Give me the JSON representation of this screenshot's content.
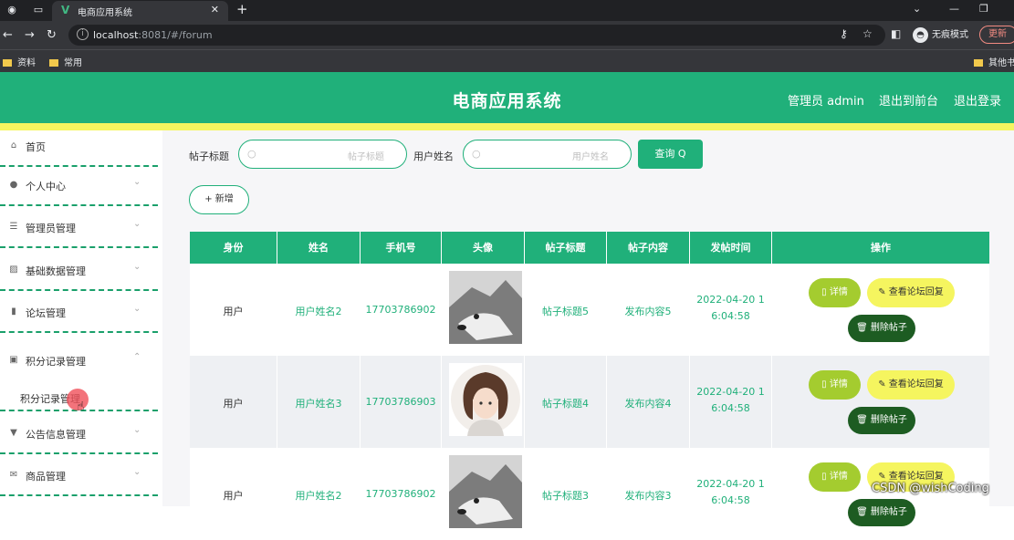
{
  "browser": {
    "tab_title": "电商应用系统",
    "tab_logo": "V",
    "close_tab_icon": "✕",
    "new_tab_icon": "+",
    "url_host": "localhost",
    "url_rest": ":8081/#/forum",
    "incognito_label": "无痕模式",
    "update_label": "更新",
    "bookmarks": [
      "资料",
      "常用"
    ],
    "other_bookmarks": "其他书"
  },
  "header": {
    "title": "电商应用系统",
    "user_label": "管理员 admin",
    "back_label": "退出到前台",
    "logout_label": "退出登录",
    "brand_color": "#20b07a",
    "band_color": "#f5f55f"
  },
  "sidebar": {
    "items": [
      {
        "label": "首页",
        "icon": "home-icon",
        "glyph": "⌂"
      },
      {
        "label": "个人中心",
        "icon": "user-icon",
        "glyph": "●"
      },
      {
        "label": "管理员管理",
        "icon": "sliders-icon",
        "glyph": "☰"
      },
      {
        "label": "基础数据管理",
        "icon": "chart-icon",
        "glyph": "▨"
      },
      {
        "label": "论坛管理",
        "icon": "bar-chart-icon",
        "glyph": "▮"
      },
      {
        "label": "积分记录管理",
        "icon": "clipboard-icon",
        "glyph": "▣"
      },
      {
        "label": "公告信息管理",
        "icon": "megaphone-icon",
        "glyph": "▼"
      },
      {
        "label": "商品管理",
        "icon": "mail-icon",
        "glyph": "✉"
      }
    ],
    "sub_item": "积分记录管理",
    "chevron_down": "⌄",
    "chevron_up": "⌃"
  },
  "search": {
    "title_label": "帖子标题",
    "title_placeholder": "帖子标题",
    "username_label": "用户姓名",
    "username_placeholder": "用户姓名",
    "query_label": "查询 Q",
    "add_label": "+ 新增"
  },
  "table": {
    "headers": [
      "身份",
      "姓名",
      "手机号",
      "头像",
      "帖子标题",
      "帖子内容",
      "发帖时间",
      "操作"
    ],
    "rows": [
      {
        "identity": "用户",
        "name": "用户姓名2",
        "phone": "17703786902",
        "avatar": "husky-dog",
        "title": "帖子标题5",
        "content": "发布内容5",
        "time": "2022-04-20 1\n6:04:58"
      },
      {
        "identity": "用户",
        "name": "用户姓名3",
        "phone": "17703786903",
        "avatar": "girl-illustration",
        "title": "帖子标题4",
        "content": "发布内容4",
        "time": "2022-04-20 1\n6:04:58"
      },
      {
        "identity": "用户",
        "name": "用户姓名2",
        "phone": "17703786902",
        "avatar": "husky-dog",
        "title": "帖子标题3",
        "content": "发布内容3",
        "time": "2022-04-20 1\n6:04:58"
      }
    ],
    "actions": {
      "detail": "▯ 详情",
      "view_reply": "✎ 查看论坛回复",
      "delete": "🗑 删除帖子"
    },
    "row_colors": [
      "#ffffff",
      "#eef0f3",
      "#ffffff"
    ]
  },
  "watermark": "CSDN @wishCoding"
}
